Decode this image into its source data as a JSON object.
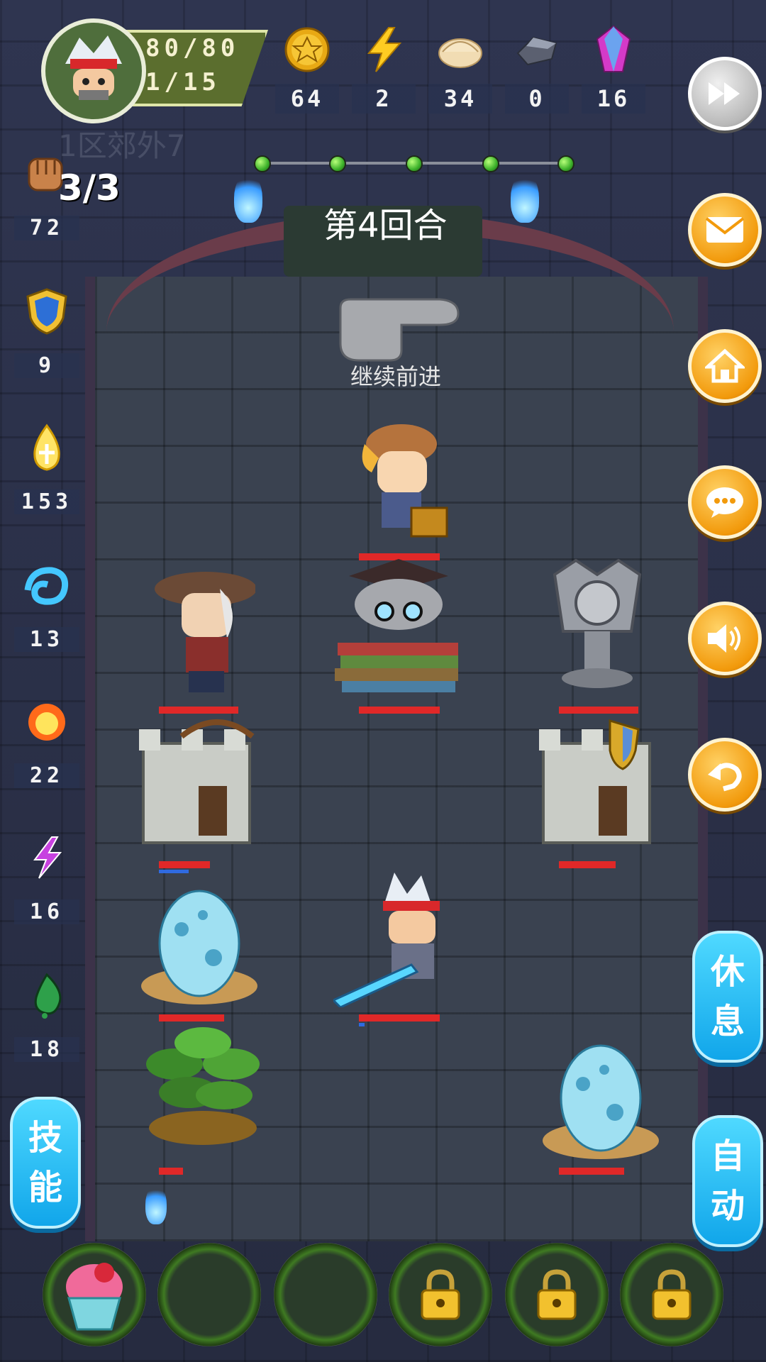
{
  "player": {
    "hp": "80/80",
    "level": "1/15"
  },
  "resources": [
    {
      "name": "gold-coin-icon",
      "value": "64"
    },
    {
      "name": "energy-bolt-icon",
      "value": "2"
    },
    {
      "name": "dumpling-icon",
      "value": "34"
    },
    {
      "name": "iron-ore-icon",
      "value": "0"
    },
    {
      "name": "crystal-icon",
      "value": "16"
    }
  ],
  "area_name": "1区郊外7",
  "round_label": "第4回合",
  "progress": {
    "total": 5,
    "reached": 5
  },
  "pointer_label": "继续前进",
  "left_stats": {
    "fist_count": "3/3",
    "attack": "72",
    "defense": "9",
    "holy": "153",
    "water": "13",
    "fire": "22",
    "lightning": "16",
    "poison": "18"
  },
  "buttons": {
    "rest": [
      "休",
      "息"
    ],
    "auto": [
      "自",
      "动"
    ],
    "skill": [
      "技",
      "能"
    ]
  },
  "colors": {
    "accent_orange": "#f29a0c",
    "accent_blue": "#11a6ea",
    "hp_red": "#e02828"
  },
  "slots": [
    {
      "item": "cupcake-icon",
      "locked": false
    },
    {
      "item": "",
      "locked": false
    },
    {
      "item": "",
      "locked": false
    },
    {
      "item": "",
      "locked": true
    },
    {
      "item": "",
      "locked": true
    },
    {
      "item": "",
      "locked": true
    }
  ]
}
